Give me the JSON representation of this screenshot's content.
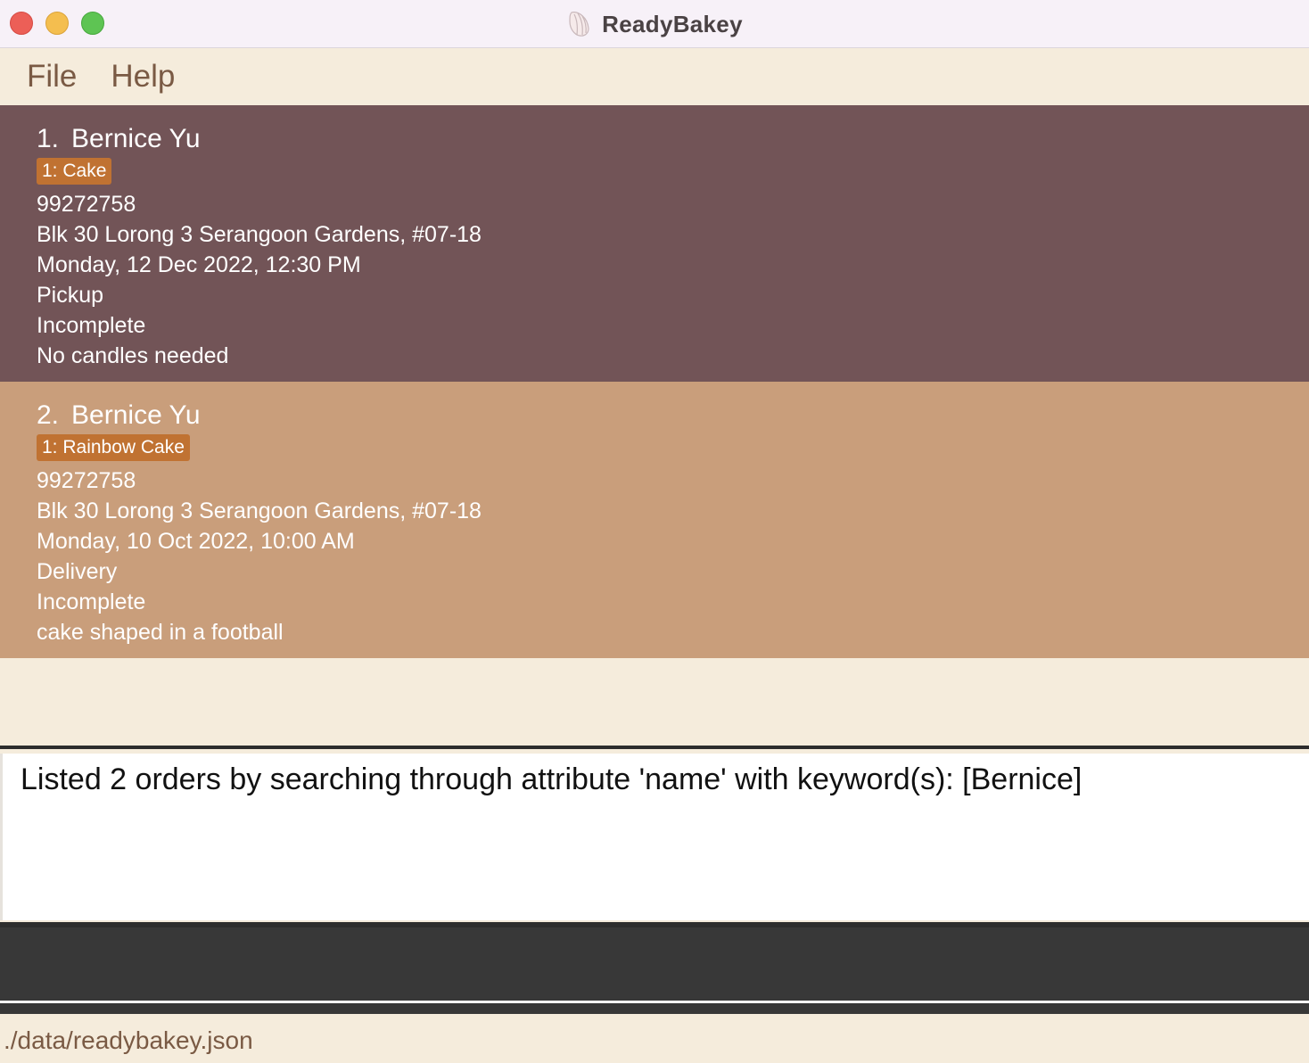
{
  "window": {
    "title": "ReadyBakey"
  },
  "menu": {
    "file": "File",
    "help": "Help"
  },
  "orders": [
    {
      "index": "1.",
      "name": "Bernice Yu",
      "tag": "1: Cake",
      "phone": "99272758",
      "address": "Blk 30 Lorong 3 Serangoon Gardens, #07-18",
      "datetime": "Monday, 12 Dec 2022, 12:30 PM",
      "delivery": "Pickup",
      "status": "Incomplete",
      "remark": "No candles needed"
    },
    {
      "index": "2.",
      "name": "Bernice Yu",
      "tag": "1: Rainbow Cake",
      "phone": "99272758",
      "address": "Blk 30 Lorong 3 Serangoon Gardens, #07-18",
      "datetime": "Monday, 10 Oct 2022, 10:00 AM",
      "delivery": "Delivery",
      "status": "Incomplete",
      "remark": "cake shaped in a football"
    }
  ],
  "result": {
    "message": "Listed 2 orders by searching through attribute 'name' with keyword(s): [Bernice]"
  },
  "command": {
    "value": ""
  },
  "status_bar": {
    "path": "./data/readybakey.json"
  },
  "colors": {
    "selected_card": "#725457",
    "card": "#c99e7b",
    "tag": "#c07232",
    "background": "#f5ecdc",
    "command_box": "#383838"
  },
  "icons": {
    "app": "croissant-icon"
  }
}
